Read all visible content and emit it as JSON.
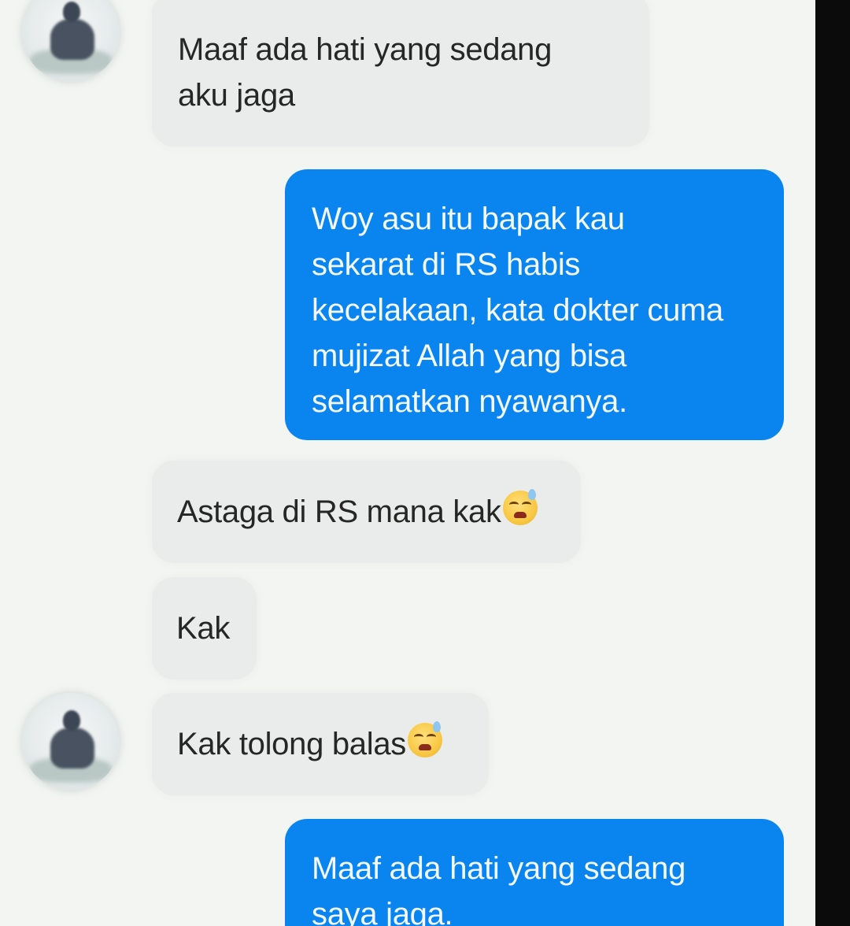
{
  "messages": [
    {
      "direction": "incoming",
      "text": "Maaf ada hati yang sedang\naku jaga"
    },
    {
      "direction": "outgoing",
      "text": "Woy asu itu bapak kau\nsekarat di RS habis\nkecelakaan, kata dokter cuma\nmujizat Allah yang bisa\nselamatkan nyawanya."
    },
    {
      "direction": "incoming",
      "text": "Astaga di RS mana kak",
      "emoji": "downcast-sweat-face-icon"
    },
    {
      "direction": "incoming",
      "text": "Kak"
    },
    {
      "direction": "incoming",
      "text": "Kak tolong balas",
      "emoji": "downcast-sweat-face-icon"
    },
    {
      "direction": "outgoing",
      "text": "Maaf ada hati yang sedang\nsaya jaga."
    }
  ],
  "colors": {
    "background": "#f2f5f1",
    "incoming_bubble": "#e9ecea",
    "outgoing_bubble": "#0a85f0",
    "incoming_text": "#262626",
    "outgoing_text": "#f4f8ff"
  }
}
